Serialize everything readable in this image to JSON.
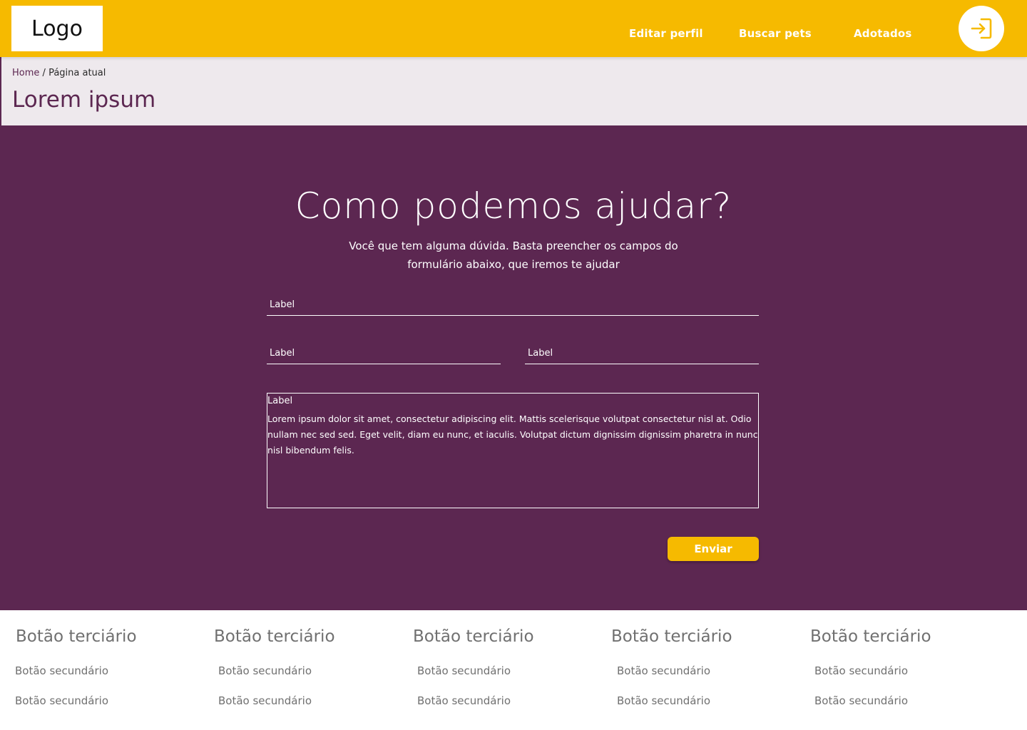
{
  "header": {
    "logo": "Logo",
    "nav": [
      "Editar perfil",
      "Buscar pets",
      "Adotados"
    ],
    "login_icon": "login-arrow-icon",
    "background_color": "#F6BA00"
  },
  "breadcrumb": {
    "home": "Home",
    "separator": "/",
    "current": "Página atual"
  },
  "page_title": "Lorem ipsum",
  "contact": {
    "title": "Como podemos ajudar?",
    "subtitle": "Você que tem alguma dúvida. Basta preencher os campos do formulário abaixo, que iremos te ajudar",
    "field_full_placeholder": "Label",
    "field_left_placeholder": "Label",
    "field_right_placeholder": "Label",
    "textarea_label": "Label",
    "textarea_value": "Lorem ipsum dolor sit amet, consectetur adipiscing elit. Mattis scelerisque volutpat consectetur nisl at. Odio nullam nec sed sed. Eget velit, diam eu nunc, et iaculis. Volutpat dictum dignissim dignissim pharetra in nunc nisl bibendum felis.",
    "submit_label": "Enviar",
    "background_color": "#5C2751"
  },
  "footer": {
    "columns": [
      {
        "title": "Botão terciário",
        "links": [
          "Botão secundário",
          "Botão secundário"
        ]
      },
      {
        "title": "Botão terciário",
        "links": [
          "Botão secundário",
          "Botão secundário"
        ]
      },
      {
        "title": "Botão terciário",
        "links": [
          "Botão secundário",
          "Botão secundário"
        ]
      },
      {
        "title": "Botão terciário",
        "links": [
          "Botão secundário",
          "Botão secundário"
        ]
      },
      {
        "title": "Botão terciário",
        "links": [
          "Botão secundário",
          "Botão secundário"
        ]
      }
    ]
  }
}
